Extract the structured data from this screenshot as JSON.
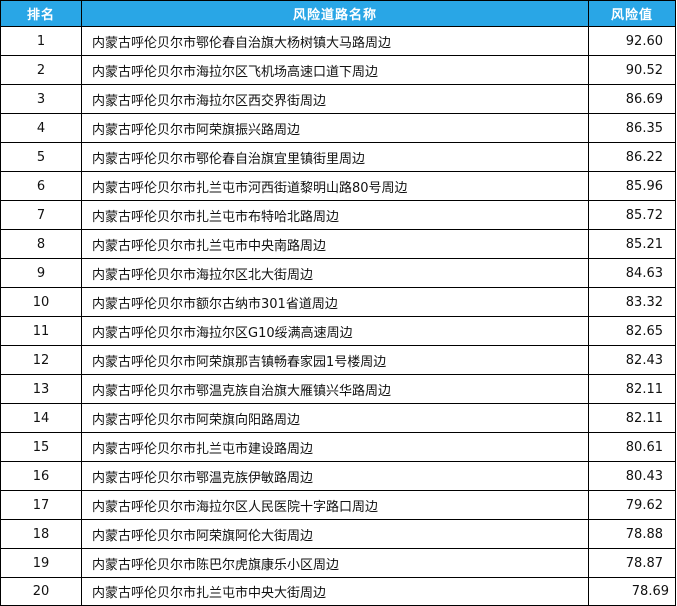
{
  "header": {
    "rank": "排名",
    "road": "风险道路名称",
    "value": "风险值"
  },
  "rows": [
    {
      "rank": "1",
      "road": "内蒙古呼伦贝尔市鄂伦春自治旗大杨树镇大马路周边",
      "value": "92.60"
    },
    {
      "rank": "2",
      "road": "内蒙古呼伦贝尔市海拉尔区飞机场高速口道下周边",
      "value": "90.52"
    },
    {
      "rank": "3",
      "road": "内蒙古呼伦贝尔市海拉尔区西交界街周边",
      "value": "86.69"
    },
    {
      "rank": "4",
      "road": "内蒙古呼伦贝尔市阿荣旗振兴路周边",
      "value": "86.35"
    },
    {
      "rank": "5",
      "road": "内蒙古呼伦贝尔市鄂伦春自治旗宜里镇街里周边",
      "value": "86.22"
    },
    {
      "rank": "6",
      "road": "内蒙古呼伦贝尔市扎兰屯市河西街道黎明山路80号周边",
      "value": "85.96"
    },
    {
      "rank": "7",
      "road": "内蒙古呼伦贝尔市扎兰屯市布特哈北路周边",
      "value": "85.72"
    },
    {
      "rank": "8",
      "road": "内蒙古呼伦贝尔市扎兰屯市中央南路周边",
      "value": "85.21"
    },
    {
      "rank": "9",
      "road": "内蒙古呼伦贝尔市海拉尔区北大街周边",
      "value": "84.63"
    },
    {
      "rank": "10",
      "road": "内蒙古呼伦贝尔市额尔古纳市301省道周边",
      "value": "83.32"
    },
    {
      "rank": "11",
      "road": "内蒙古呼伦贝尔市海拉尔区G10绥满高速周边",
      "value": "82.65"
    },
    {
      "rank": "12",
      "road": "内蒙古呼伦贝尔市阿荣旗那吉镇畅春家园1号楼周边",
      "value": "82.43"
    },
    {
      "rank": "13",
      "road": "内蒙古呼伦贝尔市鄂温克族自治旗大雁镇兴华路周边",
      "value": "82.11"
    },
    {
      "rank": "14",
      "road": "内蒙古呼伦贝尔市阿荣旗向阳路周边",
      "value": "82.11"
    },
    {
      "rank": "15",
      "road": "内蒙古呼伦贝尔市扎兰屯市建设路周边",
      "value": "80.61"
    },
    {
      "rank": "16",
      "road": "内蒙古呼伦贝尔市鄂温克族伊敏路周边",
      "value": "80.43"
    },
    {
      "rank": "17",
      "road": "内蒙古呼伦贝尔市海拉尔区人民医院十字路口周边",
      "value": "79.62"
    },
    {
      "rank": "18",
      "road": "内蒙古呼伦贝尔市阿荣旗阿伦大街周边",
      "value": "78.88"
    },
    {
      "rank": "19",
      "road": "内蒙古呼伦贝尔市陈巴尔虎旗康乐小区周边",
      "value": "78.87"
    },
    {
      "rank": "20",
      "road": "内蒙古呼伦贝尔市扎兰屯市中央大街周边",
      "value": "78.69"
    }
  ]
}
